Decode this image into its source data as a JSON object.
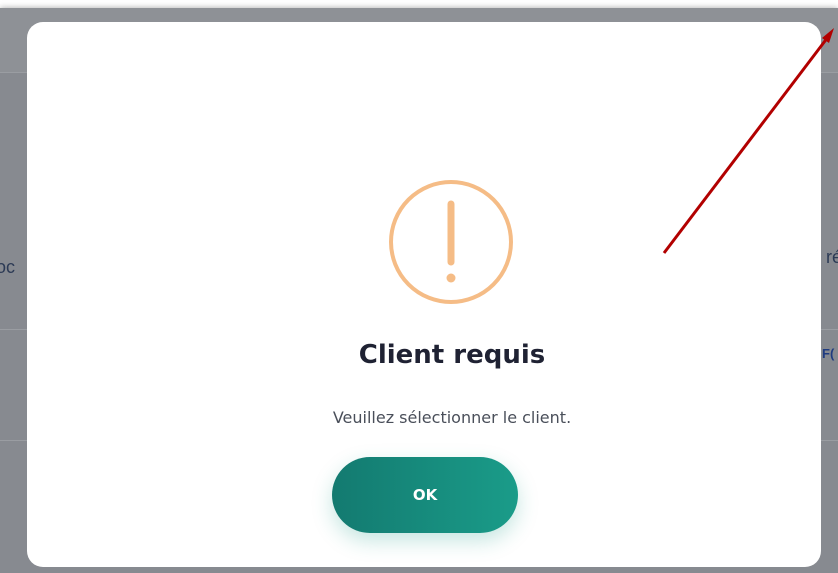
{
  "background": {
    "left_fragment": "oc",
    "right_fragment": "ré",
    "right_fragment_2": "F("
  },
  "dialog": {
    "icon": "warning-exclamation-circle-icon",
    "title": "Client requis",
    "message": "Veuillez sélectionner le client.",
    "ok_label": "OK"
  },
  "colors": {
    "icon_accent": "#F5BC86",
    "button_start": "#137A70",
    "button_end": "#1A9C89",
    "annotation_arrow": "#B20000"
  }
}
